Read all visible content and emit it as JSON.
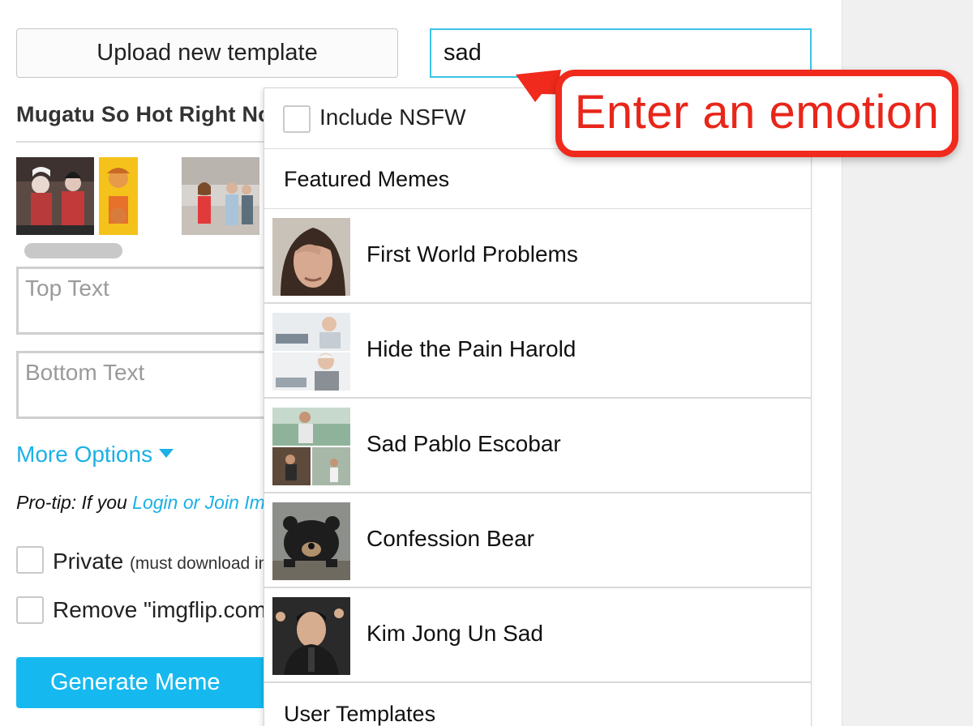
{
  "upload": {
    "label": "Upload new template"
  },
  "template": {
    "title": "Mugatu So Hot Right Now"
  },
  "text_fields": {
    "top_placeholder": "Top Text",
    "bottom_placeholder": "Bottom Text"
  },
  "more_options": {
    "label": "More Options"
  },
  "protip": {
    "prefix": "Pro-tip: If you ",
    "link": "Login or Join Imgflip"
  },
  "options": {
    "private_label": "Private",
    "private_note": "(must download image)",
    "remove_label": "Remove \"imgflip.com\" watermark"
  },
  "generate": {
    "label": "Generate Meme"
  },
  "search": {
    "value": "sad"
  },
  "dropdown": {
    "nsfw_label": "Include NSFW",
    "featured_header": "Featured Memes",
    "items": [
      {
        "name": "First World Problems"
      },
      {
        "name": "Hide the Pain Harold"
      },
      {
        "name": "Sad Pablo Escobar"
      },
      {
        "name": "Confession Bear"
      },
      {
        "name": "Kim Jong Un Sad"
      }
    ],
    "user_header": "User Templates"
  },
  "annotation": {
    "text": "Enter an emotion"
  },
  "colors": {
    "accent": "#16b9ef",
    "callout_red": "#f02a1c"
  }
}
